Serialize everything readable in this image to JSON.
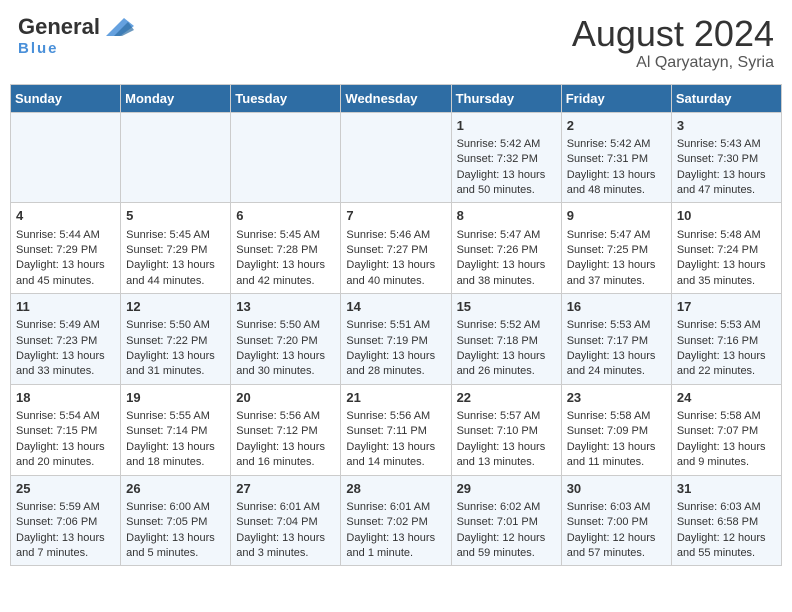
{
  "header": {
    "logo_general": "General",
    "logo_blue": "Blue",
    "month_year": "August 2024",
    "location": "Al Qaryatayn, Syria"
  },
  "days_of_week": [
    "Sunday",
    "Monday",
    "Tuesday",
    "Wednesday",
    "Thursday",
    "Friday",
    "Saturday"
  ],
  "weeks": [
    {
      "days": [
        {
          "num": "",
          "lines": []
        },
        {
          "num": "",
          "lines": []
        },
        {
          "num": "",
          "lines": []
        },
        {
          "num": "",
          "lines": []
        },
        {
          "num": "1",
          "lines": [
            "Sunrise: 5:42 AM",
            "Sunset: 7:32 PM",
            "Daylight: 13 hours",
            "and 50 minutes."
          ]
        },
        {
          "num": "2",
          "lines": [
            "Sunrise: 5:42 AM",
            "Sunset: 7:31 PM",
            "Daylight: 13 hours",
            "and 48 minutes."
          ]
        },
        {
          "num": "3",
          "lines": [
            "Sunrise: 5:43 AM",
            "Sunset: 7:30 PM",
            "Daylight: 13 hours",
            "and 47 minutes."
          ]
        }
      ]
    },
    {
      "days": [
        {
          "num": "4",
          "lines": [
            "Sunrise: 5:44 AM",
            "Sunset: 7:29 PM",
            "Daylight: 13 hours",
            "and 45 minutes."
          ]
        },
        {
          "num": "5",
          "lines": [
            "Sunrise: 5:45 AM",
            "Sunset: 7:29 PM",
            "Daylight: 13 hours",
            "and 44 minutes."
          ]
        },
        {
          "num": "6",
          "lines": [
            "Sunrise: 5:45 AM",
            "Sunset: 7:28 PM",
            "Daylight: 13 hours",
            "and 42 minutes."
          ]
        },
        {
          "num": "7",
          "lines": [
            "Sunrise: 5:46 AM",
            "Sunset: 7:27 PM",
            "Daylight: 13 hours",
            "and 40 minutes."
          ]
        },
        {
          "num": "8",
          "lines": [
            "Sunrise: 5:47 AM",
            "Sunset: 7:26 PM",
            "Daylight: 13 hours",
            "and 38 minutes."
          ]
        },
        {
          "num": "9",
          "lines": [
            "Sunrise: 5:47 AM",
            "Sunset: 7:25 PM",
            "Daylight: 13 hours",
            "and 37 minutes."
          ]
        },
        {
          "num": "10",
          "lines": [
            "Sunrise: 5:48 AM",
            "Sunset: 7:24 PM",
            "Daylight: 13 hours",
            "and 35 minutes."
          ]
        }
      ]
    },
    {
      "days": [
        {
          "num": "11",
          "lines": [
            "Sunrise: 5:49 AM",
            "Sunset: 7:23 PM",
            "Daylight: 13 hours",
            "and 33 minutes."
          ]
        },
        {
          "num": "12",
          "lines": [
            "Sunrise: 5:50 AM",
            "Sunset: 7:22 PM",
            "Daylight: 13 hours",
            "and 31 minutes."
          ]
        },
        {
          "num": "13",
          "lines": [
            "Sunrise: 5:50 AM",
            "Sunset: 7:20 PM",
            "Daylight: 13 hours",
            "and 30 minutes."
          ]
        },
        {
          "num": "14",
          "lines": [
            "Sunrise: 5:51 AM",
            "Sunset: 7:19 PM",
            "Daylight: 13 hours",
            "and 28 minutes."
          ]
        },
        {
          "num": "15",
          "lines": [
            "Sunrise: 5:52 AM",
            "Sunset: 7:18 PM",
            "Daylight: 13 hours",
            "and 26 minutes."
          ]
        },
        {
          "num": "16",
          "lines": [
            "Sunrise: 5:53 AM",
            "Sunset: 7:17 PM",
            "Daylight: 13 hours",
            "and 24 minutes."
          ]
        },
        {
          "num": "17",
          "lines": [
            "Sunrise: 5:53 AM",
            "Sunset: 7:16 PM",
            "Daylight: 13 hours",
            "and 22 minutes."
          ]
        }
      ]
    },
    {
      "days": [
        {
          "num": "18",
          "lines": [
            "Sunrise: 5:54 AM",
            "Sunset: 7:15 PM",
            "Daylight: 13 hours",
            "and 20 minutes."
          ]
        },
        {
          "num": "19",
          "lines": [
            "Sunrise: 5:55 AM",
            "Sunset: 7:14 PM",
            "Daylight: 13 hours",
            "and 18 minutes."
          ]
        },
        {
          "num": "20",
          "lines": [
            "Sunrise: 5:56 AM",
            "Sunset: 7:12 PM",
            "Daylight: 13 hours",
            "and 16 minutes."
          ]
        },
        {
          "num": "21",
          "lines": [
            "Sunrise: 5:56 AM",
            "Sunset: 7:11 PM",
            "Daylight: 13 hours",
            "and 14 minutes."
          ]
        },
        {
          "num": "22",
          "lines": [
            "Sunrise: 5:57 AM",
            "Sunset: 7:10 PM",
            "Daylight: 13 hours",
            "and 13 minutes."
          ]
        },
        {
          "num": "23",
          "lines": [
            "Sunrise: 5:58 AM",
            "Sunset: 7:09 PM",
            "Daylight: 13 hours",
            "and 11 minutes."
          ]
        },
        {
          "num": "24",
          "lines": [
            "Sunrise: 5:58 AM",
            "Sunset: 7:07 PM",
            "Daylight: 13 hours",
            "and 9 minutes."
          ]
        }
      ]
    },
    {
      "days": [
        {
          "num": "25",
          "lines": [
            "Sunrise: 5:59 AM",
            "Sunset: 7:06 PM",
            "Daylight: 13 hours",
            "and 7 minutes."
          ]
        },
        {
          "num": "26",
          "lines": [
            "Sunrise: 6:00 AM",
            "Sunset: 7:05 PM",
            "Daylight: 13 hours",
            "and 5 minutes."
          ]
        },
        {
          "num": "27",
          "lines": [
            "Sunrise: 6:01 AM",
            "Sunset: 7:04 PM",
            "Daylight: 13 hours",
            "and 3 minutes."
          ]
        },
        {
          "num": "28",
          "lines": [
            "Sunrise: 6:01 AM",
            "Sunset: 7:02 PM",
            "Daylight: 13 hours",
            "and 1 minute."
          ]
        },
        {
          "num": "29",
          "lines": [
            "Sunrise: 6:02 AM",
            "Sunset: 7:01 PM",
            "Daylight: 12 hours",
            "and 59 minutes."
          ]
        },
        {
          "num": "30",
          "lines": [
            "Sunrise: 6:03 AM",
            "Sunset: 7:00 PM",
            "Daylight: 12 hours",
            "and 57 minutes."
          ]
        },
        {
          "num": "31",
          "lines": [
            "Sunrise: 6:03 AM",
            "Sunset: 6:58 PM",
            "Daylight: 12 hours",
            "and 55 minutes."
          ]
        }
      ]
    }
  ]
}
